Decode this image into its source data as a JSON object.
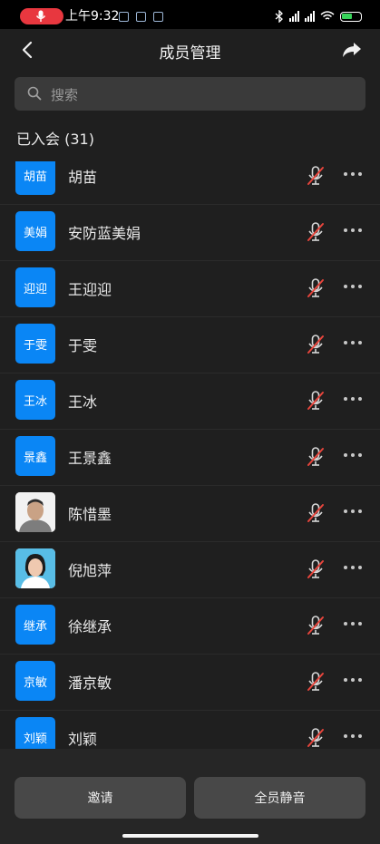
{
  "status": {
    "time": "上午9:32"
  },
  "header": {
    "title": "成员管理"
  },
  "search": {
    "placeholder": "搜索"
  },
  "section": {
    "joined_label": "已入会 (31)"
  },
  "members": [
    {
      "name": "胡苗",
      "avatar_text": "胡苗",
      "avatar_type": "text"
    },
    {
      "name": "安防蓝美娟",
      "avatar_text": "美娟",
      "avatar_type": "text"
    },
    {
      "name": "王迎迎",
      "avatar_text": "迎迎",
      "avatar_type": "text"
    },
    {
      "name": "于雯",
      "avatar_text": "于雯",
      "avatar_type": "text"
    },
    {
      "name": "王冰",
      "avatar_text": "王冰",
      "avatar_type": "text"
    },
    {
      "name": "王景鑫",
      "avatar_text": "景鑫",
      "avatar_type": "text"
    },
    {
      "name": "陈惜墨",
      "avatar_text": "",
      "avatar_type": "photo-man"
    },
    {
      "name": "倪旭萍",
      "avatar_text": "",
      "avatar_type": "photo-woman"
    },
    {
      "name": "徐继承",
      "avatar_text": "继承",
      "avatar_type": "text"
    },
    {
      "name": "潘京敏",
      "avatar_text": "京敏",
      "avatar_type": "text"
    },
    {
      "name": "刘颖",
      "avatar_text": "刘颖",
      "avatar_type": "text"
    }
  ],
  "footer": {
    "invite_label": "邀请",
    "mute_all_label": "全员静音"
  },
  "colors": {
    "avatar_blue": "#0a86f5",
    "mute_slash": "#e8453c",
    "record_red": "#e8373f"
  }
}
